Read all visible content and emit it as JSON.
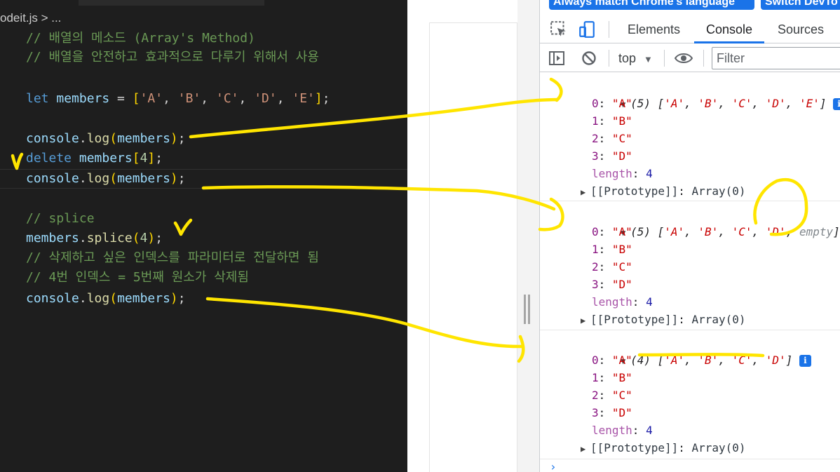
{
  "editor": {
    "breadcrumb": "odeit.js > ...",
    "lines": [
      {
        "id": "l1",
        "parts": [
          {
            "t": "// 배열의 메소드 (Array's Method)",
            "c": "c-cmt"
          }
        ]
      },
      {
        "id": "l2",
        "parts": [
          {
            "t": "// 배열을 안전하고 효과적으로 다루기 위해서 사용",
            "c": "c-cmt"
          }
        ]
      },
      {
        "id": "l3",
        "parts": [
          {
            "t": "let",
            "c": "c-kw"
          },
          {
            "t": " ",
            "c": "c-punc"
          },
          {
            "t": "members",
            "c": "c-var"
          },
          {
            "t": " = ",
            "c": "c-punc"
          },
          {
            "t": "[",
            "c": "c-br"
          },
          {
            "t": "'A'",
            "c": "c-str"
          },
          {
            "t": ", ",
            "c": "c-punc"
          },
          {
            "t": "'B'",
            "c": "c-str"
          },
          {
            "t": ", ",
            "c": "c-punc"
          },
          {
            "t": "'C'",
            "c": "c-str"
          },
          {
            "t": ", ",
            "c": "c-punc"
          },
          {
            "t": "'D'",
            "c": "c-str"
          },
          {
            "t": ", ",
            "c": "c-punc"
          },
          {
            "t": "'E'",
            "c": "c-str"
          },
          {
            "t": "]",
            "c": "c-br"
          },
          {
            "t": ";",
            "c": "c-punc"
          }
        ]
      },
      {
        "id": "l4",
        "parts": [
          {
            "t": "console",
            "c": "c-var"
          },
          {
            "t": ".",
            "c": "c-punc"
          },
          {
            "t": "log",
            "c": "c-fn"
          },
          {
            "t": "(",
            "c": "c-br"
          },
          {
            "t": "members",
            "c": "c-var"
          },
          {
            "t": ")",
            "c": "c-br"
          },
          {
            "t": ";",
            "c": "c-punc"
          }
        ]
      },
      {
        "id": "l5",
        "parts": [
          {
            "t": "delete",
            "c": "c-kw"
          },
          {
            "t": " ",
            "c": "c-punc"
          },
          {
            "t": "members",
            "c": "c-var"
          },
          {
            "t": "[",
            "c": "c-br"
          },
          {
            "t": "4",
            "c": "c-num"
          },
          {
            "t": "]",
            "c": "c-br"
          },
          {
            "t": ";",
            "c": "c-punc"
          }
        ]
      },
      {
        "id": "l6",
        "parts": [
          {
            "t": "console",
            "c": "c-var"
          },
          {
            "t": ".",
            "c": "c-punc"
          },
          {
            "t": "log",
            "c": "c-fn"
          },
          {
            "t": "(",
            "c": "c-br"
          },
          {
            "t": "members",
            "c": "c-var"
          },
          {
            "t": ")",
            "c": "c-br"
          },
          {
            "t": ";",
            "c": "c-punc"
          }
        ]
      },
      {
        "id": "l7",
        "parts": [
          {
            "t": "// splice",
            "c": "c-cmt"
          }
        ]
      },
      {
        "id": "l8",
        "parts": [
          {
            "t": "members",
            "c": "c-var"
          },
          {
            "t": ".",
            "c": "c-punc"
          },
          {
            "t": "splice",
            "c": "c-fn"
          },
          {
            "t": "(",
            "c": "c-br"
          },
          {
            "t": "4",
            "c": "c-num"
          },
          {
            "t": ")",
            "c": "c-br"
          },
          {
            "t": ";",
            "c": "c-punc"
          }
        ]
      },
      {
        "id": "l9",
        "parts": [
          {
            "t": "// 삭제하고 싶은 인덱스를 파라미터로 전달하면 됨",
            "c": "c-cmt"
          }
        ]
      },
      {
        "id": "l10",
        "parts": [
          {
            "t": "// 4번 인덱스 = 5번째 원소가 삭제됨",
            "c": "c-cmt"
          }
        ]
      },
      {
        "id": "l11",
        "parts": [
          {
            "t": "console",
            "c": "c-var"
          },
          {
            "t": ".",
            "c": "c-punc"
          },
          {
            "t": "log",
            "c": "c-fn"
          },
          {
            "t": "(",
            "c": "c-br"
          },
          {
            "t": "members",
            "c": "c-var"
          },
          {
            "t": ")",
            "c": "c-br"
          },
          {
            "t": ";",
            "c": "c-punc"
          }
        ]
      }
    ]
  },
  "devtools": {
    "info_buttons": [
      "Always match Chrome's language",
      "Switch DevTo"
    ],
    "tabs": [
      "Elements",
      "Console",
      "Sources"
    ],
    "active_tab": "Console",
    "context": "top",
    "filter_placeholder": "Filter",
    "icons": [
      "inspect-element-icon",
      "device-toolbar-icon",
      "sidebar-toggle-icon",
      "clear-console-icon",
      "eye-icon"
    ],
    "logs": [
      {
        "summary_count": "(5)",
        "summary_items": [
          "'A'",
          "'B'",
          "'C'",
          "'D'",
          "'E'"
        ],
        "entries": [
          [
            "0",
            "\"A\""
          ],
          [
            "1",
            "\"B\""
          ],
          [
            "2",
            "\"C\""
          ],
          [
            "3",
            "\"D\""
          ]
        ],
        "length_key": "length",
        "length_val": "4",
        "proto_key": "[[Prototype]]",
        "proto_val": "Array(0)"
      },
      {
        "summary_count": "(5)",
        "summary_items": [
          "'A'",
          "'B'",
          "'C'",
          "'D'"
        ],
        "summary_empty": "empty",
        "entries": [
          [
            "0",
            "\"A\""
          ],
          [
            "1",
            "\"B\""
          ],
          [
            "2",
            "\"C\""
          ],
          [
            "3",
            "\"D\""
          ]
        ],
        "length_key": "length",
        "length_val": "4",
        "proto_key": "[[Prototype]]",
        "proto_val": "Array(0)"
      },
      {
        "summary_count": "(4)",
        "summary_items": [
          "'A'",
          "'B'",
          "'C'",
          "'D'"
        ],
        "entries": [
          [
            "0",
            "\"A\""
          ],
          [
            "1",
            "\"B\""
          ],
          [
            "2",
            "\"C\""
          ],
          [
            "3",
            "\"D\""
          ]
        ],
        "length_key": "length",
        "length_val": "4",
        "proto_key": "[[Prototype]]",
        "proto_val": "Array(0)"
      }
    ],
    "prompt": "›"
  },
  "annotation_color": "#ffe500"
}
